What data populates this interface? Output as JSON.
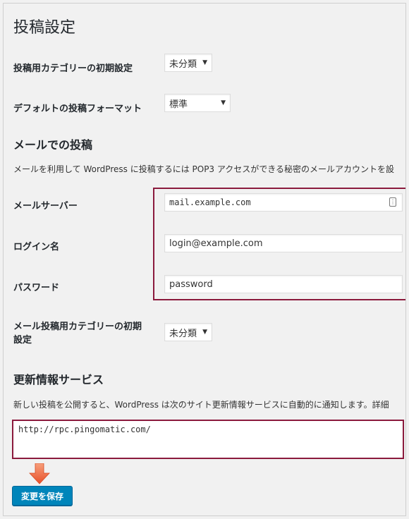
{
  "page": {
    "title": "投稿設定"
  },
  "default_category": {
    "label": "投稿用カテゴリーの初期設定",
    "selected": "未分類"
  },
  "default_format": {
    "label": "デフォルトの投稿フォーマット",
    "selected": "標準"
  },
  "post_via_email": {
    "heading": "メールでの投稿",
    "description": "メールを利用して WordPress に投稿するには POP3 アクセスができる秘密のメールアカウントを設",
    "mail_server": {
      "label": "メールサーバー",
      "value": "mail.example.com"
    },
    "login_name": {
      "label": "ログイン名",
      "value": "login@example.com"
    },
    "password": {
      "label": "パスワード",
      "value": "password"
    },
    "mail_category": {
      "label_line1": "メール投稿用カテゴリーの初期",
      "label_line2": "設定",
      "selected": "未分類"
    }
  },
  "update_services": {
    "heading": "更新情報サービス",
    "description": "新しい投稿を公開すると、WordPress は次のサイト更新情報サービスに自動的に通知します。詳細",
    "ping_urls": "http://rpc.pingomatic.com/"
  },
  "actions": {
    "save_label": "変更を保存"
  },
  "colors": {
    "highlight": "#8b1a3d",
    "arrow": "#f0693c",
    "button": "#0085ba"
  }
}
